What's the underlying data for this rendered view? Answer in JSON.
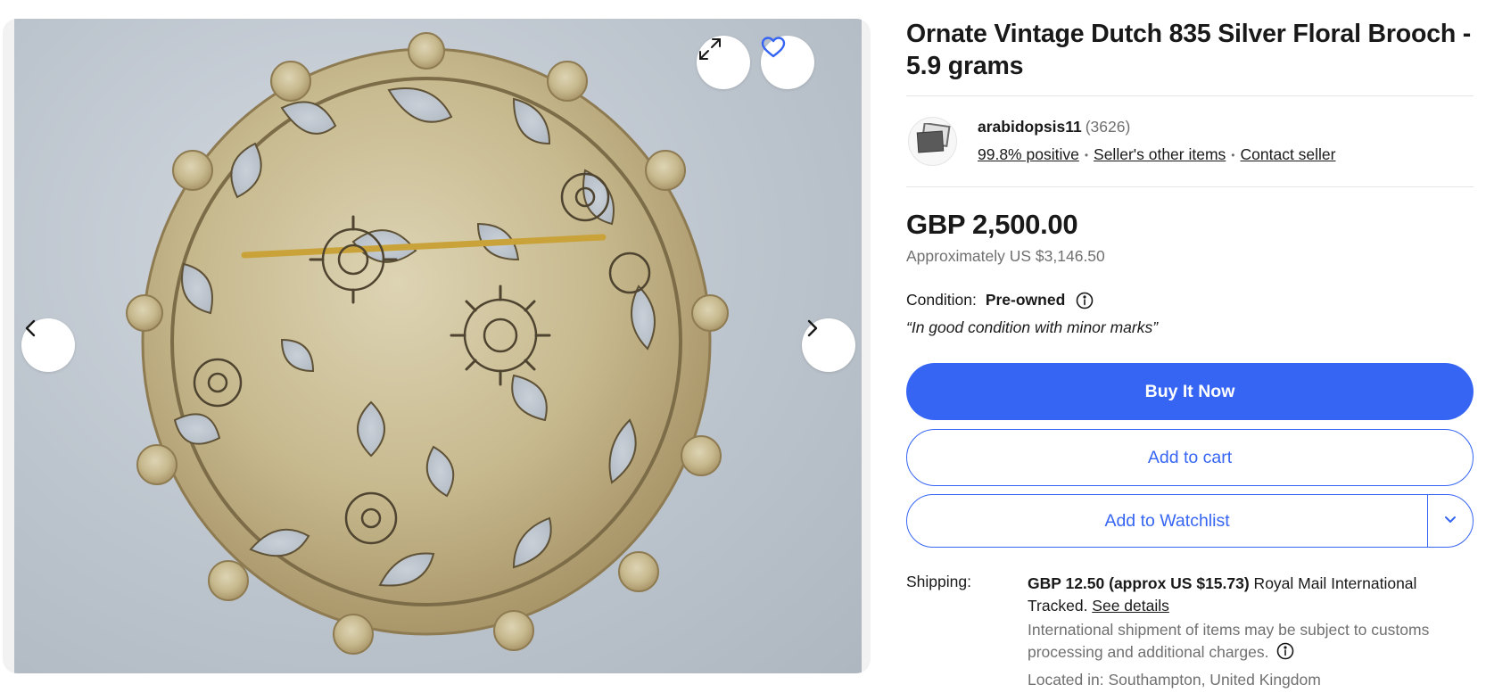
{
  "gallery": {
    "image_alt": "Ornate Vintage Dutch 835 Silver Floral Brooch",
    "icons": {
      "expand": "expand-icon",
      "favorite": "heart-icon",
      "previous": "chevron-left-icon",
      "next": "chevron-right-icon"
    }
  },
  "item": {
    "title": "Ornate Vintage Dutch 835 Silver Floral Brooch - 5.9 grams"
  },
  "seller": {
    "name": "arabidopsis11",
    "feedback_count": "(3626)",
    "positive": "99.8% positive",
    "other_items": "Seller's other items",
    "contact": "Contact seller"
  },
  "pricing": {
    "price": "GBP 2,500.00",
    "approx": "Approximately US $3,146.50"
  },
  "condition": {
    "label": "Condition:",
    "value": "Pre-owned",
    "quote": "“In good condition with minor marks”"
  },
  "actions": {
    "buy_now": "Buy It Now",
    "add_to_cart": "Add to cart",
    "add_to_watchlist": "Add to Watchlist"
  },
  "shipping": {
    "label": "Shipping:",
    "cost": "GBP 12.50 (approx US $15.73)",
    "service": " Royal Mail International Tracked. ",
    "details_link": "See details",
    "note": "International shipment of items may be subject to customs processing and additional charges.",
    "location": "Located in: Southampton, United Kingdom"
  },
  "colors": {
    "accent": "#3665f3",
    "text": "#191919",
    "muted": "#707070"
  }
}
